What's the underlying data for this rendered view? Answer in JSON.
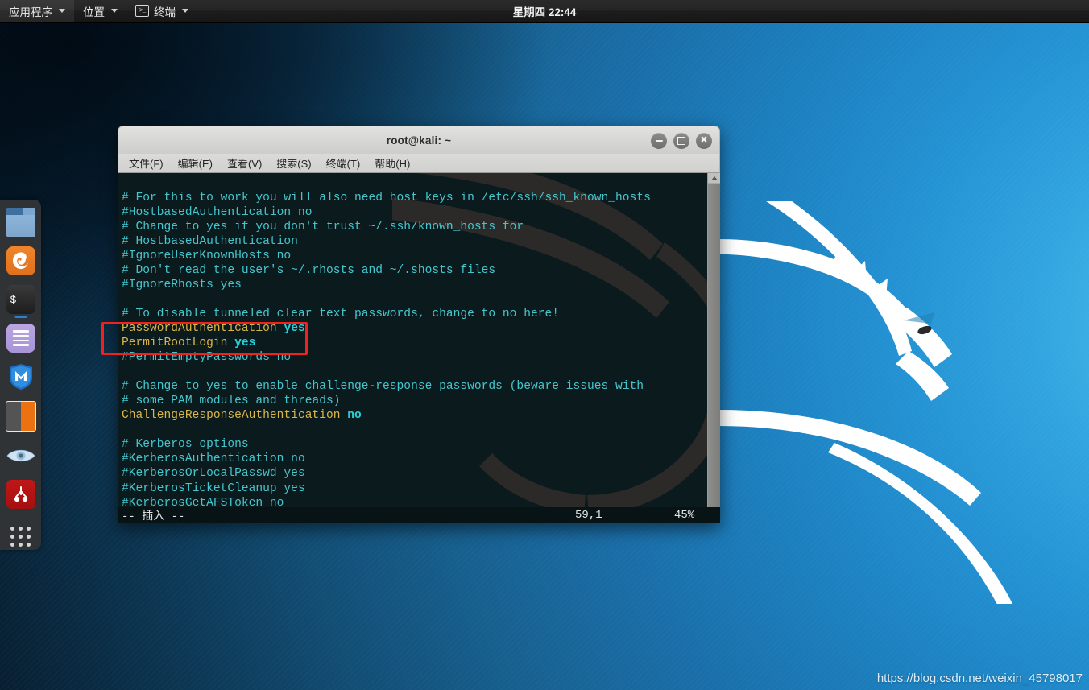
{
  "top_panel": {
    "applications_label": "应用程序",
    "places_label": "位置",
    "terminal_label": "终端",
    "clock": "星期四 22:44"
  },
  "dock": {
    "items": [
      {
        "name": "files",
        "label": "文件"
      },
      {
        "name": "firefox",
        "label": "Firefox ESR"
      },
      {
        "name": "terminal",
        "label": "终端",
        "running": true
      },
      {
        "name": "text-editor",
        "label": "文本编辑器"
      },
      {
        "name": "metasploit",
        "label": "Metasploit Framework"
      },
      {
        "name": "zenmap",
        "label": "Zenmap"
      },
      {
        "name": "wireshark",
        "label": "Wireshark"
      },
      {
        "name": "beef",
        "label": "BeEF"
      },
      {
        "name": "show-applications",
        "label": "显示应用程序"
      }
    ]
  },
  "terminal": {
    "title": "root@kali: ~",
    "menu": [
      "文件(F)",
      "编辑(E)",
      "查看(V)",
      "搜索(S)",
      "终端(T)",
      "帮助(H)"
    ],
    "window_buttons": {
      "minimize": "minimize",
      "maximize": "maximize",
      "close": "close"
    },
    "lines": [
      {
        "t": "comment",
        "text": "# For this to work you will also need host keys in /etc/ssh/ssh_known_hosts"
      },
      {
        "t": "comment",
        "text": "#HostbasedAuthentication no"
      },
      {
        "t": "comment",
        "text": "# Change to yes if you don't trust ~/.ssh/known_hosts for"
      },
      {
        "t": "comment",
        "text": "# HostbasedAuthentication"
      },
      {
        "t": "comment",
        "text": "#IgnoreUserKnownHosts no"
      },
      {
        "t": "comment",
        "text": "# Don't read the user's ~/.rhosts and ~/.shosts files"
      },
      {
        "t": "comment",
        "text": "#IgnoreRhosts yes"
      },
      {
        "t": "blank",
        "text": ""
      },
      {
        "t": "comment",
        "text": "# To disable tunneled clear text passwords, change to no here!"
      },
      {
        "t": "kv",
        "key": "PasswordAuthentication",
        "value": "yes"
      },
      {
        "t": "kv",
        "key": "PermitRootLogin",
        "value": "yes"
      },
      {
        "t": "comment",
        "text": "#PermitEmptyPasswords no"
      },
      {
        "t": "blank",
        "text": ""
      },
      {
        "t": "comment",
        "text": "# Change to yes to enable challenge-response passwords (beware issues with"
      },
      {
        "t": "comment",
        "text": "# some PAM modules and threads)"
      },
      {
        "t": "kv",
        "key": "ChallengeResponseAuthentication",
        "value": "no"
      },
      {
        "t": "blank",
        "text": ""
      },
      {
        "t": "comment",
        "text": "# Kerberos options"
      },
      {
        "t": "comment",
        "text": "#KerberosAuthentication no"
      },
      {
        "t": "comment",
        "text": "#KerberosOrLocalPasswd yes"
      },
      {
        "t": "comment",
        "text": "#KerberosTicketCleanup yes"
      },
      {
        "t": "comment",
        "text": "#KerberosGetAFSToken no"
      }
    ],
    "status": {
      "mode": "-- 插入 --",
      "position": "59,1",
      "percent": "45%"
    },
    "colors": {
      "background": "#0b1a1d",
      "comment": "#45c6cd",
      "key": "#d9b64a",
      "value": "#27d0d8",
      "status_bg": "#081315"
    }
  },
  "annotation": {
    "name": "red-highlight-box",
    "color": "#f32020"
  },
  "watermark": {
    "text": "https://blog.csdn.net/weixin_45798017"
  }
}
